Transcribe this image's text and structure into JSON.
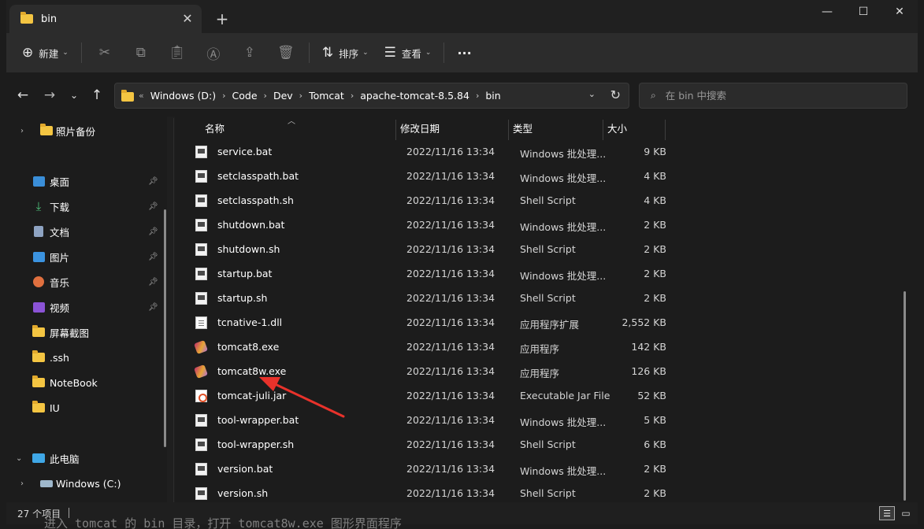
{
  "window": {
    "tab_title": "bin",
    "tab_close": "✕",
    "new_tab": "+",
    "controls": {
      "minimize": "—",
      "maximize": "☐",
      "close": "✕"
    }
  },
  "toolbar": {
    "new_label": "新建",
    "sort_label": "排序",
    "view_label": "查看",
    "more_label": "···"
  },
  "address": {
    "overflow": "«",
    "crumbs": [
      "Windows (D:)",
      "Code",
      "Dev",
      "Tomcat",
      "apache-tomcat-8.5.84",
      "bin"
    ],
    "search_placeholder": "在 bin 中搜索"
  },
  "sidebar": {
    "items": [
      {
        "label": "照片备份",
        "pinned": false
      },
      {
        "label": "桌面",
        "pinned": true
      },
      {
        "label": "下载",
        "pinned": true
      },
      {
        "label": "文档",
        "pinned": true
      },
      {
        "label": "图片",
        "pinned": true
      },
      {
        "label": "音乐",
        "pinned": true
      },
      {
        "label": "视频",
        "pinned": true
      },
      {
        "label": "屏幕截图",
        "pinned": false
      },
      {
        "label": ".ssh",
        "pinned": false
      },
      {
        "label": "NoteBook",
        "pinned": false
      },
      {
        "label": "IU",
        "pinned": false
      },
      {
        "label": "此电脑",
        "pinned": false
      },
      {
        "label": "Windows (C:)",
        "pinned": false
      }
    ]
  },
  "columns": {
    "name": "名称",
    "date": "修改日期",
    "type": "类型",
    "size": "大小"
  },
  "files": [
    {
      "name": "service.bat",
      "date": "2022/11/16 13:34",
      "type": "Windows 批处理...",
      "size": "9 KB",
      "kind": "bat"
    },
    {
      "name": "setclasspath.bat",
      "date": "2022/11/16 13:34",
      "type": "Windows 批处理...",
      "size": "4 KB",
      "kind": "bat"
    },
    {
      "name": "setclasspath.sh",
      "date": "2022/11/16 13:34",
      "type": "Shell Script",
      "size": "4 KB",
      "kind": "bat"
    },
    {
      "name": "shutdown.bat",
      "date": "2022/11/16 13:34",
      "type": "Windows 批处理...",
      "size": "2 KB",
      "kind": "bat"
    },
    {
      "name": "shutdown.sh",
      "date": "2022/11/16 13:34",
      "type": "Shell Script",
      "size": "2 KB",
      "kind": "bat"
    },
    {
      "name": "startup.bat",
      "date": "2022/11/16 13:34",
      "type": "Windows 批处理...",
      "size": "2 KB",
      "kind": "bat"
    },
    {
      "name": "startup.sh",
      "date": "2022/11/16 13:34",
      "type": "Shell Script",
      "size": "2 KB",
      "kind": "bat"
    },
    {
      "name": "tcnative-1.dll",
      "date": "2022/11/16 13:34",
      "type": "应用程序扩展",
      "size": "2,552 KB",
      "kind": "dll"
    },
    {
      "name": "tomcat8.exe",
      "date": "2022/11/16 13:34",
      "type": "应用程序",
      "size": "142 KB",
      "kind": "exe"
    },
    {
      "name": "tomcat8w.exe",
      "date": "2022/11/16 13:34",
      "type": "应用程序",
      "size": "126 KB",
      "kind": "exe"
    },
    {
      "name": "tomcat-juli.jar",
      "date": "2022/11/16 13:34",
      "type": "Executable Jar File",
      "size": "52 KB",
      "kind": "jar"
    },
    {
      "name": "tool-wrapper.bat",
      "date": "2022/11/16 13:34",
      "type": "Windows 批处理...",
      "size": "5 KB",
      "kind": "bat"
    },
    {
      "name": "tool-wrapper.sh",
      "date": "2022/11/16 13:34",
      "type": "Shell Script",
      "size": "6 KB",
      "kind": "bat"
    },
    {
      "name": "version.bat",
      "date": "2022/11/16 13:34",
      "type": "Windows 批处理...",
      "size": "2 KB",
      "kind": "bat"
    },
    {
      "name": "version.sh",
      "date": "2022/11/16 13:34",
      "type": "Shell Script",
      "size": "2 KB",
      "kind": "bat"
    }
  ],
  "status": {
    "count": "27 个项目"
  },
  "caption": "进入 tomcat 的 bin 目录，打开 tomcat8w.exe 图形界面程序",
  "colors": {
    "annotation_arrow": "#e8322b",
    "folder": "#f4c542"
  }
}
